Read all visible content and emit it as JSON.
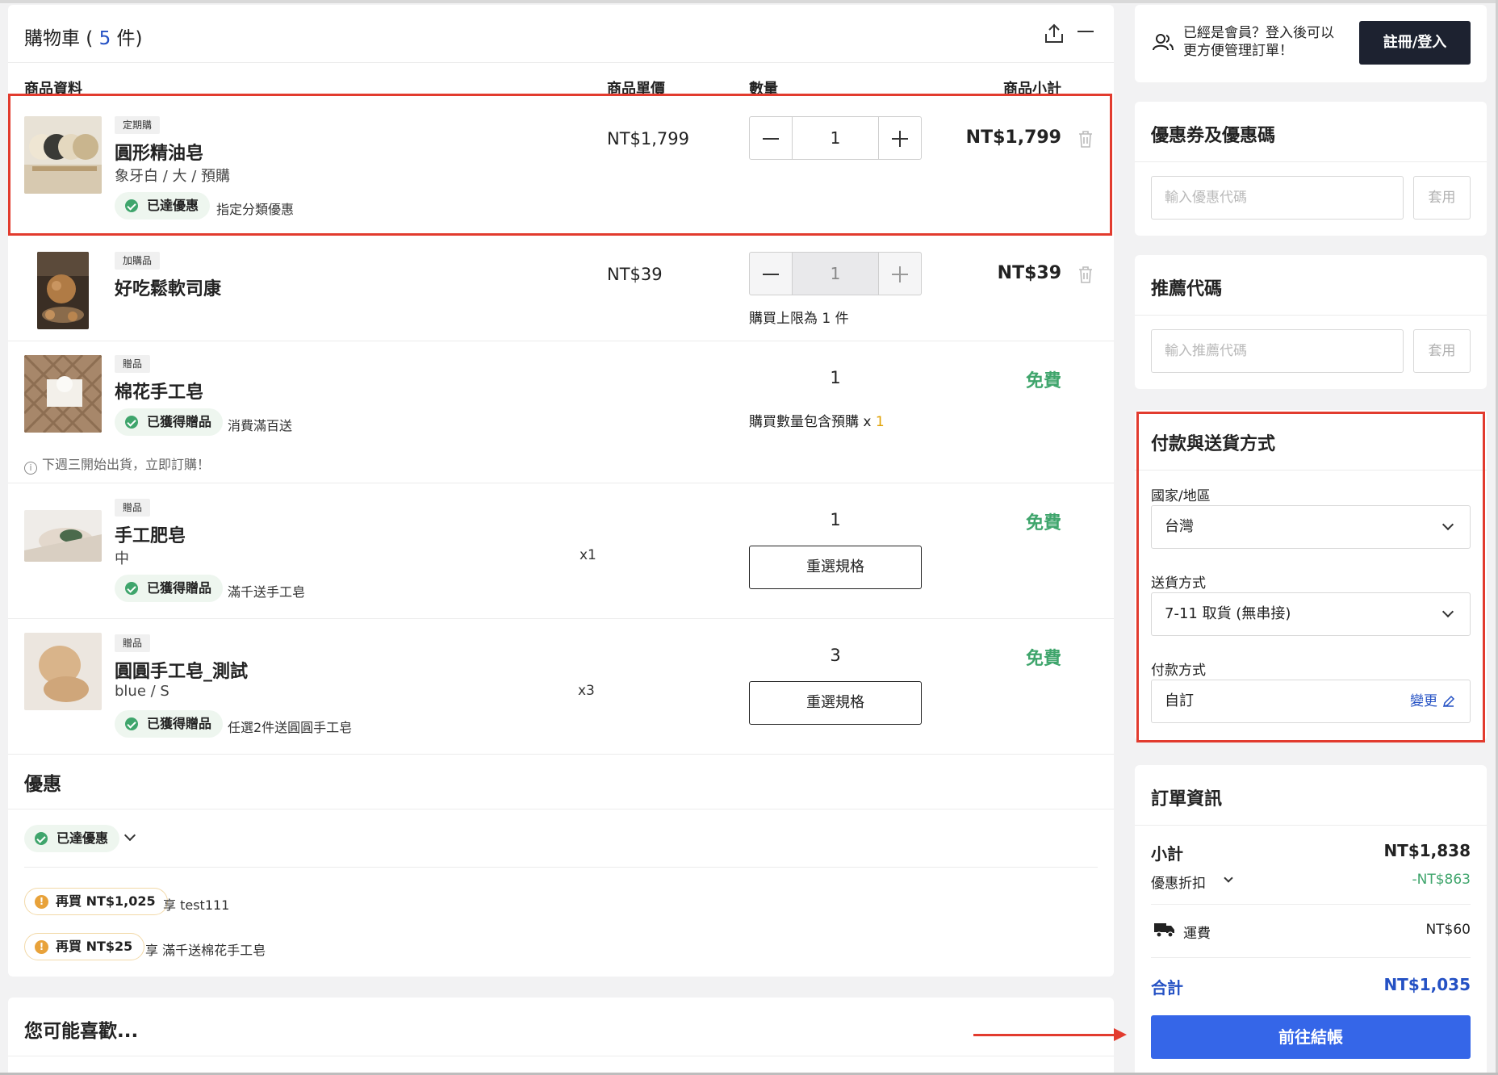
{
  "cart": {
    "title": "購物車",
    "count_open": " ( ",
    "count": "5",
    "count_close": " 件)",
    "columns": {
      "info": "商品資料",
      "unit_price": "商品單價",
      "qty": "數量",
      "subtotal": "商品小計"
    },
    "items": [
      {
        "tag": "定期購",
        "name": "圓形精油皂",
        "variant": "象牙白 / 大 / 預購",
        "price": "NT$1,799",
        "qty": "1",
        "subtotal": "NT$1,799",
        "badge": "已達優惠",
        "badge_note": "指定分類優惠"
      },
      {
        "tag": "加購品",
        "name": "好吃鬆軟司康",
        "price": "NT$39",
        "qty": "1",
        "subtotal": "NT$39",
        "qty_note": "購買上限為 1 件"
      },
      {
        "tag": "贈品",
        "name": "棉花手工皂",
        "qty": "1",
        "subtotal": "免費",
        "badge": "已獲得贈品",
        "badge_note": "消費滿百送",
        "qty_note": "購買數量包含預購 x ",
        "qty_note_hl": "1",
        "ship_note": "下週三開始出貨，立即訂購！"
      },
      {
        "tag": "贈品",
        "name": "手工肥皂",
        "variant": "中",
        "xqty": "x1",
        "qty": "1",
        "subtotal": "免費",
        "reselect": "重選規格",
        "badge": "已獲得贈品",
        "badge_note": "滿千送手工皂"
      },
      {
        "tag": "贈品",
        "name": "圓圓手工皂_測試",
        "variant": "blue / S",
        "xqty": "x3",
        "qty": "3",
        "subtotal": "免費",
        "reselect": "重選規格",
        "badge": "已獲得贈品",
        "badge_note": "任選2件送圓圓手工皂"
      }
    ]
  },
  "promos": {
    "title": "優惠",
    "achieved": "已達優惠",
    "offers": [
      {
        "label": "再買 NT$1,025",
        "note": "享 test111"
      },
      {
        "label": "再買 NT$25",
        "note": "享 滿千送棉花手工皂"
      }
    ]
  },
  "recommend": {
    "title": "您可能喜歡..."
  },
  "member": {
    "line1": "已經是會員？登入後可以",
    "line2": "更方便管理訂單！",
    "login": "註冊/登入"
  },
  "coupon": {
    "title": "優惠券及優惠碼",
    "placeholder": "輸入優惠代碼",
    "apply": "套用"
  },
  "referral": {
    "title": "推薦代碼",
    "placeholder": "輸入推薦代碼",
    "apply": "套用"
  },
  "delivery": {
    "title": "付款與送貨方式",
    "country_label": "國家/地區",
    "country": "台灣",
    "ship_label": "送貨方式",
    "ship": "7-11 取貨 (無串接)",
    "pay_label": "付款方式",
    "pay": "自訂",
    "change": "變更"
  },
  "order": {
    "title": "訂單資訊",
    "subtotal_label": "小計",
    "subtotal": "NT$1,838",
    "discount_label": "優惠折扣",
    "discount": "-NT$863",
    "shipping_label": "運費",
    "shipping": "NT$60",
    "total_label": "合計",
    "total": "NT$1,035",
    "checkout": "前往結帳"
  },
  "colors": {
    "accent_blue": "#3566e8",
    "free_green": "#3fa56c",
    "highlight_red": "#e23b2e",
    "dark_button": "#1d2230"
  }
}
